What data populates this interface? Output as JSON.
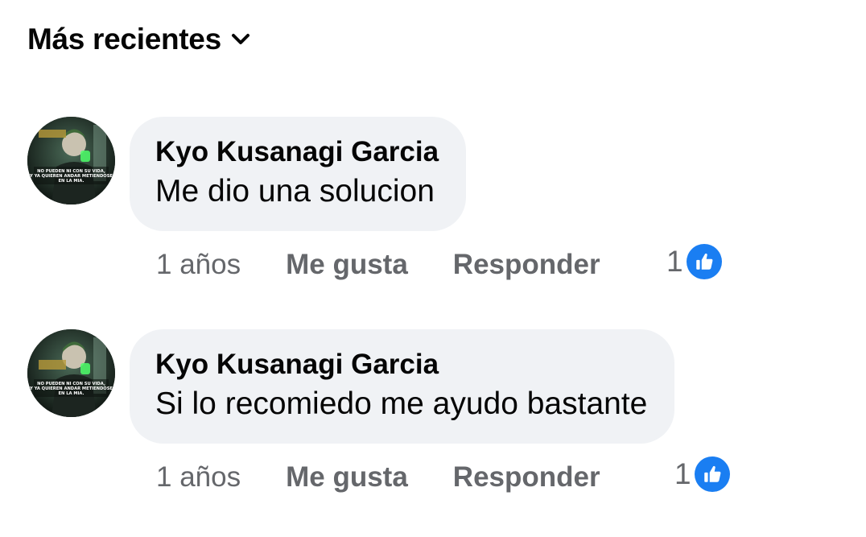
{
  "sort": {
    "label": "Más recientes"
  },
  "comments": [
    {
      "author": "Kyo Kusanagi Garcia",
      "text": "Me dio una solucion",
      "time": "1 años",
      "like_label": "Me gusta",
      "reply_label": "Responder",
      "reaction_count": "1",
      "avatar_caption": "NO PUEDEN NI CON SU VIDA, Y YA QUIEREN ANDAR METIENDOSE EN LA MIA."
    },
    {
      "author": "Kyo Kusanagi Garcia",
      "text": "Si lo recomiedo me ayudo bastante",
      "time": "1 años",
      "like_label": "Me gusta",
      "reply_label": "Responder",
      "reaction_count": "1",
      "avatar_caption": "NO PUEDEN NI CON SU VIDA, Y YA QUIEREN ANDAR METIENDOSE EN LA MIA."
    }
  ],
  "colors": {
    "bubble_bg": "#f0f2f5",
    "secondary_text": "#65676b",
    "like_blue": "#1a7ef2"
  },
  "icons": {
    "sort_chevron": "chevron-down-icon",
    "reaction": "like-thumb-icon"
  }
}
